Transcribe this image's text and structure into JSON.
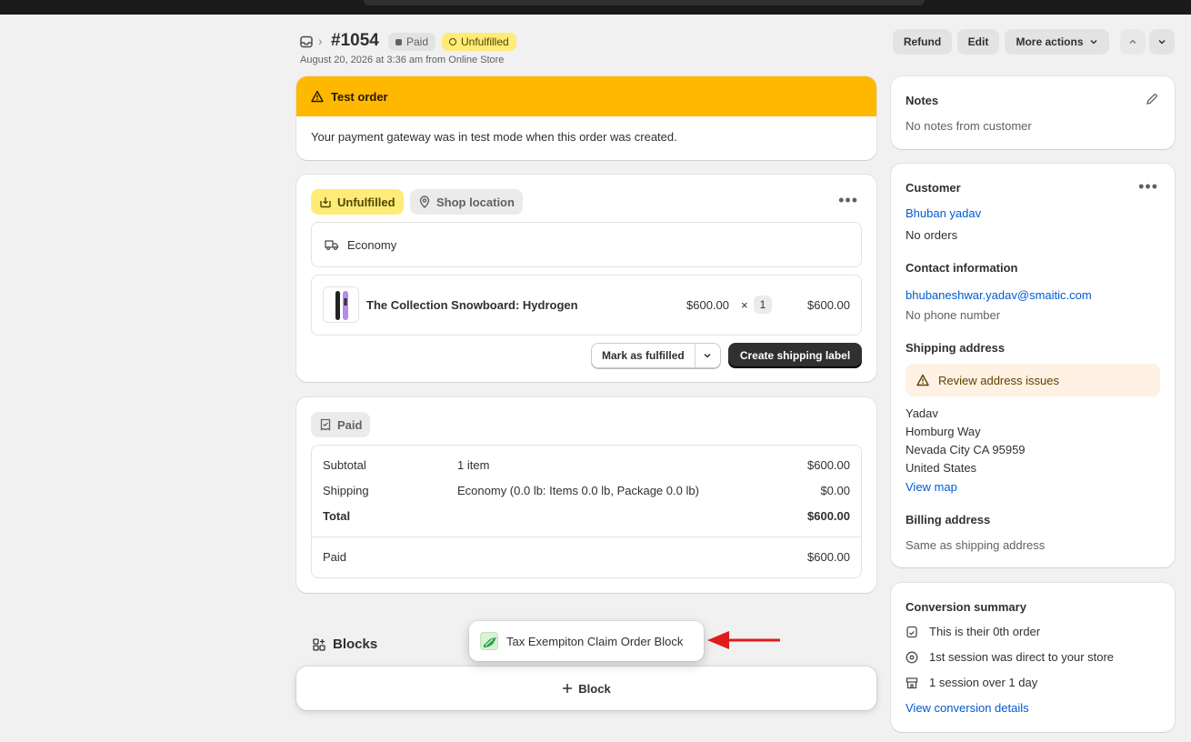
{
  "header": {
    "order_number": "#1054",
    "badge_paid": "Paid",
    "badge_unfulfilled": "Unfulfilled",
    "subline": "August 20, 2026 at 3:36 am from Online Store",
    "refund_label": "Refund",
    "edit_label": "Edit",
    "more_actions_label": "More actions"
  },
  "test_order": {
    "title": "Test order",
    "message": "Your payment gateway was in test mode when this order was created."
  },
  "fulfillment": {
    "status_label": "Unfulfilled",
    "location_label": "Shop location",
    "shipping_method": "Economy",
    "product": {
      "name": "The Collection Snowboard: Hydrogen",
      "price": "$600.00",
      "times": "×",
      "quantity": "1",
      "total": "$600.00"
    },
    "mark_fulfilled_label": "Mark as fulfilled",
    "create_label_label": "Create shipping label"
  },
  "payment": {
    "status_label": "Paid",
    "rows": [
      {
        "label": "Subtotal",
        "detail": "1 item",
        "amount": "$600.00"
      },
      {
        "label": "Shipping",
        "detail": "Economy (0.0 lb: Items 0.0 lb, Package 0.0 lb)",
        "amount": "$0.00"
      },
      {
        "label": "Total",
        "detail": "",
        "amount": "$600.00"
      }
    ],
    "paid_label": "Paid",
    "paid_amount": "$600.00"
  },
  "blocks": {
    "title": "Blocks",
    "add_label": "Block",
    "popover_label": "Tax Exempiton Claim Order Block"
  },
  "notes": {
    "title": "Notes",
    "text": "No notes from customer"
  },
  "customer": {
    "title": "Customer",
    "name": "Bhuban yadav",
    "orders": "No orders",
    "contact_title": "Contact information",
    "email": "bhubaneshwar.yadav@smaitic.com",
    "phone": "No phone number",
    "shipping_title": "Shipping address",
    "address_warning": "Review address issues",
    "address_lines": [
      "Yadav",
      "Homburg Way",
      "Nevada City CA 95959",
      "United States"
    ],
    "view_map": "View map",
    "billing_title": "Billing address",
    "billing_text": "Same as shipping address"
  },
  "conversion": {
    "title": "Conversion summary",
    "rows": [
      "This is their 0th order",
      "1st session was direct to your store",
      "1 session over 1 day"
    ],
    "link": "View conversion details"
  },
  "colors": {
    "warning": "#ffb800",
    "unfulfilled": "#ffeb78",
    "link": "#005bd3",
    "arrow": "#e01b1b"
  }
}
